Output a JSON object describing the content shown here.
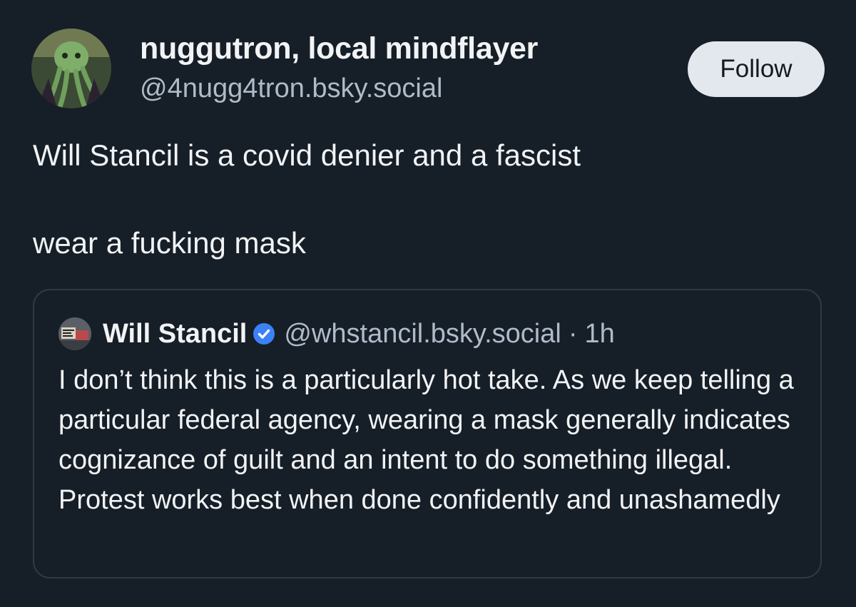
{
  "author": {
    "display_name": "nuggutron, local mindflayer",
    "handle": "@4nugg4tron.bsky.social",
    "avatar_icon": "mindflayer-avatar"
  },
  "follow_button": {
    "label": "Follow"
  },
  "post": {
    "paragraphs": [
      "Will Stancil is a covid denier and a fascist",
      "wear a fucking mask"
    ]
  },
  "quoted_post": {
    "author_name": "Will Stancil",
    "verified_icon": "verified-check-icon",
    "handle": "@whstancil.bsky.social",
    "separator": "·",
    "time": "1h",
    "text": "I don’t think this is a particularly hot take. As we keep telling a particular federal agency, wearing a mask generally indicates cognizance of guilt and an intent to do something illegal. Protest works best when done confidently and unashamedly"
  },
  "colors": {
    "background": "#161e27",
    "primary_text": "#f1f3f5",
    "secondary_text": "#aebbc9",
    "button_bg": "#e3e8ee",
    "verified_blue": "#3b82f6",
    "card_border": "#2f3a48"
  }
}
